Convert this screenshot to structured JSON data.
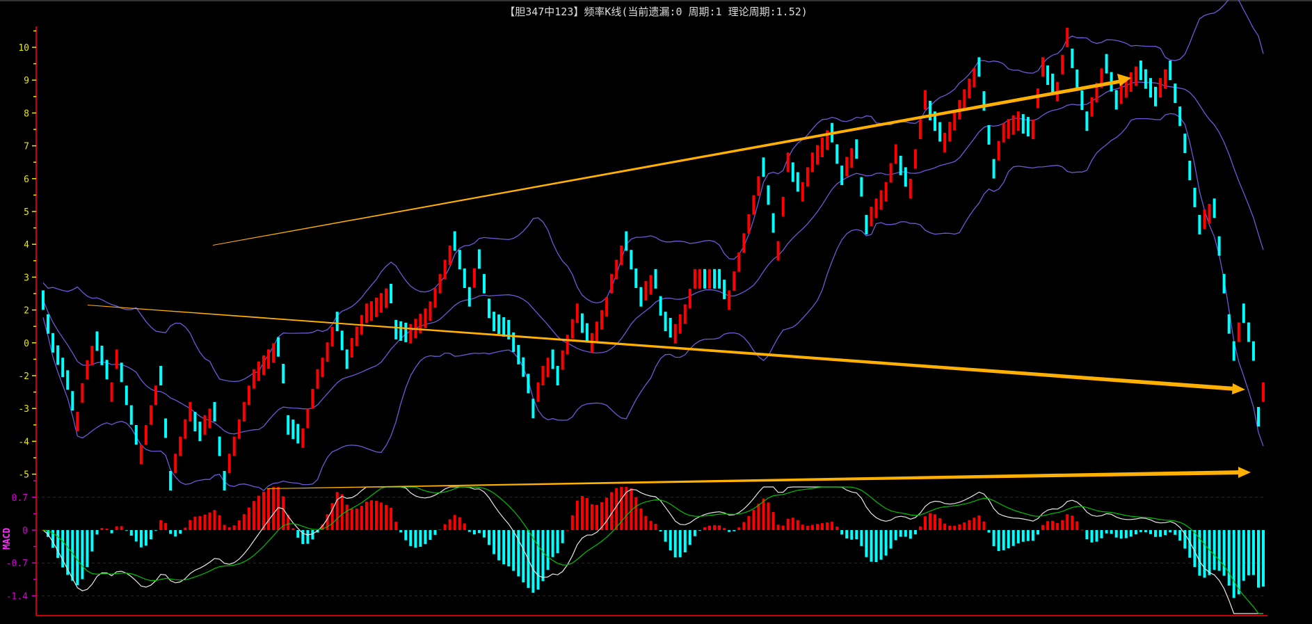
{
  "title": "【胆347中123】频率K线(当前遗漏:0 周期:1 理论周期:1.52)",
  "colors": {
    "up": "#ff0000",
    "down": "#00ffff",
    "band": "#6a5ad8",
    "axis": "#cc0000",
    "tick": "#e8e800",
    "macd_tick": "#d000d0",
    "dif": "#e8e8e8",
    "dea": "#00c000",
    "arrow": "#ffb000"
  },
  "chart_data": [
    {
      "type": "candlestick",
      "title": "【胆347中123】频率K线(当前遗漏:0 周期:1 理论周期:1.52)",
      "y_tick_labels": [
        "10",
        "9",
        "8",
        "7",
        "6",
        "5",
        "4",
        "3",
        "2",
        "0",
        "-2",
        "-3",
        "-4",
        "-5"
      ],
      "y_tick_values": [
        10,
        9,
        8,
        7,
        6,
        5,
        4,
        3,
        2,
        0,
        -2,
        -3,
        -4,
        -5
      ],
      "candle_count": 250,
      "close_waypoints": [
        [
          0,
          2.3
        ],
        [
          2,
          0
        ],
        [
          4,
          -1.5
        ],
        [
          7,
          -3.4
        ],
        [
          11,
          0.1
        ],
        [
          14,
          -2.5
        ],
        [
          15,
          -1.0
        ],
        [
          17,
          -2.6
        ],
        [
          20,
          -4.4
        ],
        [
          24,
          -2
        ],
        [
          26,
          -5.2
        ],
        [
          30,
          -3.1
        ],
        [
          32,
          -3.7
        ],
        [
          35,
          -3.1
        ],
        [
          37,
          -5.2
        ],
        [
          41,
          -3.1
        ],
        [
          43,
          -2.1
        ],
        [
          48,
          -0.25
        ],
        [
          50,
          -3.5
        ],
        [
          53,
          -3.9
        ],
        [
          57,
          -1.5
        ],
        [
          60,
          1.3
        ],
        [
          62,
          -1.0
        ],
        [
          66,
          1.8
        ],
        [
          71,
          2.5
        ],
        [
          72,
          0.8
        ],
        [
          75,
          0.55
        ],
        [
          78,
          1.5
        ],
        [
          84,
          4.1
        ],
        [
          87,
          2.4
        ],
        [
          89,
          3.55
        ],
        [
          92,
          1.3
        ],
        [
          95,
          0.8
        ],
        [
          100,
          -3
        ],
        [
          104,
          -1
        ],
        [
          105,
          -2
        ],
        [
          109,
          1.8
        ],
        [
          112,
          0
        ],
        [
          116,
          2.8
        ],
        [
          119,
          4.1
        ],
        [
          122,
          2.4
        ],
        [
          125,
          2.95
        ],
        [
          127,
          1.3
        ],
        [
          129,
          0.55
        ],
        [
          133,
          2.95
        ],
        [
          138,
          2.95
        ],
        [
          140,
          2.3
        ],
        [
          145,
          5.2
        ],
        [
          147,
          6.35
        ],
        [
          150,
          3.8
        ],
        [
          152,
          6.5
        ],
        [
          155,
          5.6
        ],
        [
          157,
          6.5
        ],
        [
          161,
          7.4
        ],
        [
          163,
          6.1
        ],
        [
          166,
          6.9
        ],
        [
          168,
          4.6
        ],
        [
          172,
          5.6
        ],
        [
          174,
          6.75
        ],
        [
          177,
          5.7
        ],
        [
          180,
          8.4
        ],
        [
          184,
          7.1
        ],
        [
          187,
          8.1
        ],
        [
          191,
          9.4
        ],
        [
          194,
          6.3
        ],
        [
          196,
          7.4
        ],
        [
          199,
          7.75
        ],
        [
          202,
          7.5
        ],
        [
          204,
          9.4
        ],
        [
          207,
          8.65
        ],
        [
          209,
          10.3
        ],
        [
          213,
          7.75
        ],
        [
          217,
          9.5
        ],
        [
          219,
          8.4
        ],
        [
          224,
          9.3
        ],
        [
          227,
          8.5
        ],
        [
          230,
          9.3
        ],
        [
          232,
          7.9
        ],
        [
          236,
          4.6
        ],
        [
          239,
          5.1
        ],
        [
          241,
          2.8
        ],
        [
          243,
          -0.5
        ],
        [
          245,
          1.8
        ],
        [
          247,
          -0.5
        ],
        [
          248,
          -3.25
        ],
        [
          249,
          -2.5
        ]
      ],
      "overlays": [
        "bollinger upper",
        "bollinger middle",
        "bollinger lower"
      ],
      "grid": false
    },
    {
      "type": "macd",
      "label": "MACD",
      "y_tick_labels": [
        "0.7",
        "0",
        "-0.7",
        "-1.4"
      ],
      "y_tick_values": [
        0.7,
        0,
        -0.7,
        -1.4
      ],
      "series": [
        "DIF",
        "DEA",
        "histogram"
      ],
      "ylim": [
        -1.7,
        0.9
      ]
    }
  ]
}
